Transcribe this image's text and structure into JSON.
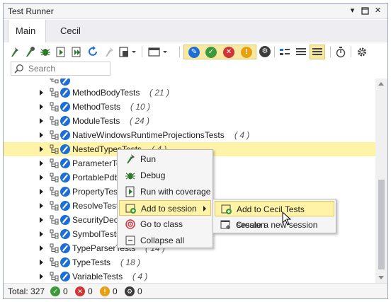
{
  "window": {
    "title": "Test Runner",
    "controls": [
      "pin-icon",
      "maximize-icon",
      "close-icon"
    ]
  },
  "tabs": [
    {
      "label": "Main",
      "active": true
    },
    {
      "label": "Cecil Tests",
      "active": false,
      "close": "×"
    }
  ],
  "toolbar": {
    "icons": [
      "run-icon",
      "debug-run-icon",
      "debug-icon",
      "run-coverage-icon",
      "run-all-coverage-icon",
      "refresh-icon",
      "stop-icon",
      "session-dropdown-icon",
      "layout-dropdown-icon",
      "toggle-all-filter-icon",
      "passed-filter-icon",
      "failed-filter-icon",
      "ignored-filter-icon",
      "unknown-filter-icon",
      "group-icon",
      "list-view-icon",
      "tree-view-icon",
      "timer-icon",
      "settings-icon"
    ],
    "colors": {
      "passed": "#3c9a3c",
      "failed": "#d13438",
      "ignored": "#e6a012",
      "unknown": "#3c3c3c",
      "all": "#1d6fd6"
    }
  },
  "search": {
    "placeholder": "Search",
    "value": ""
  },
  "tree": {
    "rows": [
      {
        "label": "MethodBodyTests",
        "count": "( 21 )"
      },
      {
        "label": "MethodTests",
        "count": "( 10 )"
      },
      {
        "label": "ModuleTests",
        "count": "( 24 )"
      },
      {
        "label": "NativeWindowsRuntimeProjectionsTests",
        "count": "( 4 )"
      },
      {
        "label": "NestedTypesTests",
        "count": "( 4 )",
        "selected": true
      },
      {
        "label": "ParameterTests",
        "count": ""
      },
      {
        "label": "PortablePdbTests",
        "count": ""
      },
      {
        "label": "PropertyTests",
        "count": ""
      },
      {
        "label": "ResolveTests",
        "count": ""
      },
      {
        "label": "SecurityDeclarationTests",
        "count": ""
      },
      {
        "label": "SymbolTests",
        "count": ""
      },
      {
        "label": "TypeParserTests",
        "count": "( 14 )"
      },
      {
        "label": "TypeTests",
        "count": "( 18 )"
      },
      {
        "label": "VariableTests",
        "count": "( 4 )"
      }
    ]
  },
  "context_menu": {
    "items": [
      {
        "label": "Run",
        "icon": "run-icon"
      },
      {
        "label": "Debug",
        "icon": "bug-icon"
      },
      {
        "label": "Run with coverage",
        "icon": "coverage-icon"
      },
      {
        "label": "Add to session",
        "icon": "add-session-icon",
        "has_submenu": true
      },
      {
        "label": "Go to class",
        "icon": "target-icon"
      },
      {
        "label": "Collapse all",
        "icon": "collapse-icon"
      }
    ],
    "submenu": [
      {
        "label": "Add to Cecil Tests session",
        "icon": "add-session-icon"
      },
      {
        "label": "Create a new session",
        "icon": "new-session-icon"
      }
    ]
  },
  "status": {
    "total_label": "Total: 327",
    "passed": "0",
    "failed": "0",
    "ignored": "0",
    "unknown": "0"
  }
}
